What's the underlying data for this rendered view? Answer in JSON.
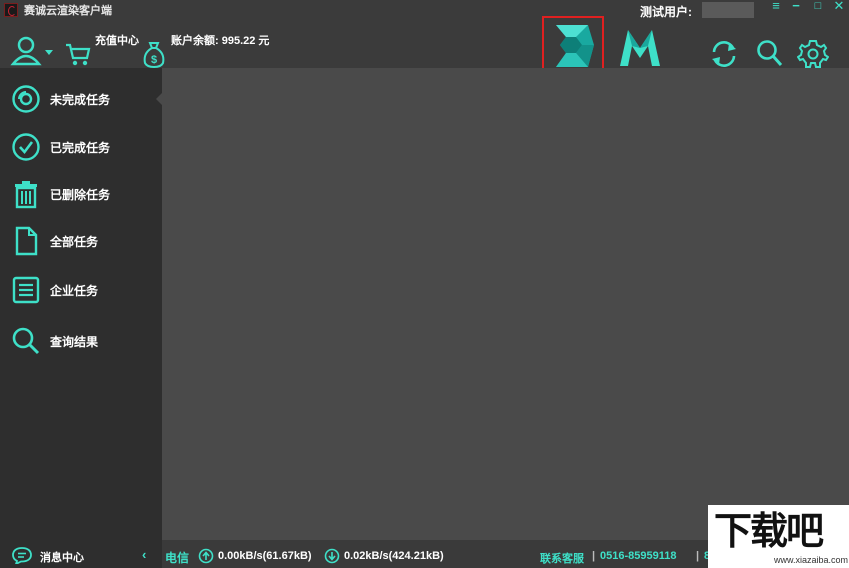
{
  "window": {
    "title": "赛诚云渲染客户端",
    "user_label": "测试用户:",
    "controls": {
      "menu": "≡",
      "minimize": "−",
      "maximize": "□",
      "close": "✕"
    }
  },
  "toolbar": {
    "recharge_label": "充值中心",
    "balance_label": "账户余额:  995.22 元",
    "icons": [
      "user-icon",
      "cart-icon",
      "money-bag-icon",
      "3dsmax-icon",
      "maya-icon",
      "refresh-icon",
      "search-icon",
      "settings-icon"
    ]
  },
  "sidebar": {
    "items": [
      {
        "label": "未完成任务",
        "icon": "incomplete-icon"
      },
      {
        "label": "已完成任务",
        "icon": "check-circle-icon"
      },
      {
        "label": "已删除任务",
        "icon": "trash-icon"
      },
      {
        "label": "全部任务",
        "icon": "document-icon"
      },
      {
        "label": "企业任务",
        "icon": "list-icon"
      },
      {
        "label": "查询结果",
        "icon": "search-icon"
      }
    ],
    "message_center": "消息中心"
  },
  "status": {
    "network": "电信",
    "upload": "0.00kB/s(61.67kB)",
    "download": "0.02kB/s(424.21kB)",
    "support_label": "联系客服",
    "separator": "|",
    "phone": "0516-85959118",
    "extra": "8"
  },
  "watermark": {
    "text": "下载吧",
    "url": "www.xiazaiba.com"
  },
  "colors": {
    "accent": "#3ee0c8",
    "highlight": "#e02020"
  }
}
